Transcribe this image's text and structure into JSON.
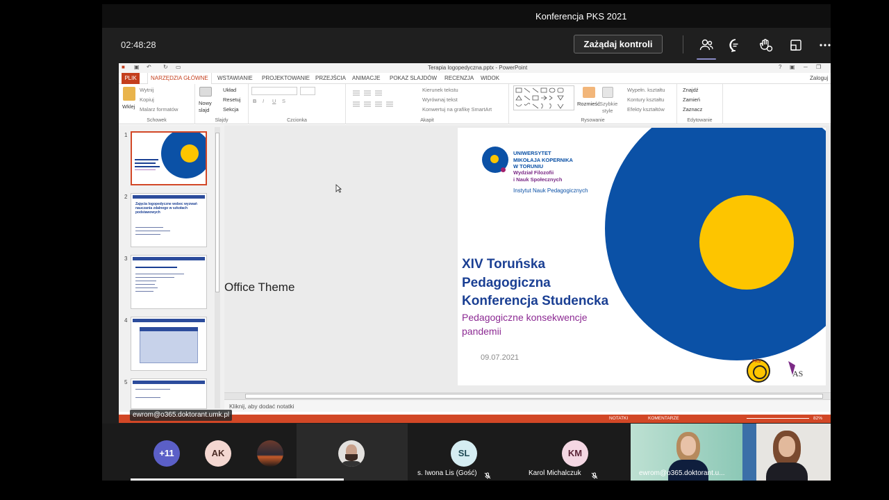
{
  "window": {
    "title": "Konferencja PKS 2021"
  },
  "controls": {
    "timer": "02:48:28",
    "request_control": "Zażądaj kontroli"
  },
  "ppt": {
    "title": "Terapia logopedyczna.pptx - PowerPoint",
    "signin": "Zaloguj",
    "tabs": [
      "PLIK",
      "NARZĘDZIA GŁÓWNE",
      "WSTAWIANIE",
      "PROJEKTOWANIE",
      "PRZEJŚCIA",
      "ANIMACJE",
      "POKAZ SLAJDÓW",
      "RECENZJA",
      "WIDOK"
    ],
    "ribbon": {
      "clipboard": {
        "paste": "Wklej",
        "cut": "Wytnij",
        "copy": "Kopiuj",
        "format_painter": "Malarz formatów",
        "group": "Schowek"
      },
      "slides": {
        "new_slide_1": "Nowy",
        "new_slide_2": "slajd",
        "layout": "Układ",
        "reset": "Resetuj",
        "section": "Sekcja",
        "group": "Slajdy"
      },
      "font": {
        "group": "Czcionka"
      },
      "paragraph": {
        "text_direction": "Kierunek tekstu",
        "align_text": "Wyrównaj tekst",
        "smartart": "Konwertuj na grafikę SmartArt",
        "group": "Akapit"
      },
      "drawing": {
        "arrange": "Rozmieść",
        "quick_styles_1": "Szybkie",
        "quick_styles_2": "style",
        "fill": "Wypełn. kształtu",
        "outline": "Kontury kształtu",
        "effects": "Efekty kształtów",
        "group": "Rysowanie"
      },
      "editing": {
        "find": "Znajdź",
        "replace": "Zamień",
        "select": "Zaznacz",
        "group": "Edytowanie"
      }
    },
    "slide_numbers": [
      "1",
      "2",
      "3",
      "4",
      "5"
    ],
    "thumb2_title": "Zajęcia logopedyczne wobec wyzwań nauczania zdalnego w szkołach podstawowych",
    "office_theme": "Office Theme",
    "notes_placeholder": "Kliknij, aby dodać notatki",
    "status": {
      "notes": "NOTATKI",
      "comments": "KOMENTARZE",
      "zoom": "82%"
    }
  },
  "slide": {
    "uni_lines": [
      "UNIWERSYTET",
      "MIKOŁAJA KOPERNIKA",
      "W TORUNIU"
    ],
    "faculty_lines": [
      "Wydział Filozofii",
      "i Nauk Społecznych"
    ],
    "institute": "Instytut Nauk Pedagogicznych",
    "title_lines": [
      "XIV Toruńska",
      "Pedagogiczna",
      "Konferencja Studencka"
    ],
    "subtitle_lines": [
      "Pedagogiczne konsekwencje",
      "pandemii"
    ],
    "date": "09.07.2021",
    "pks_logo_text": "PKS"
  },
  "presenter_tag": "ewrom@o365.doktorant.umk.pl",
  "participants": [
    {
      "label": "+11",
      "color": "#5b5fc7",
      "text_color": "#ffffff"
    },
    {
      "label": "AK",
      "color": "#f4d7d1",
      "text_color": "#4a2a24"
    },
    {
      "name": "s. Iwona Lis (Gość)",
      "initials": "SL",
      "color": "#d5edf2",
      "text_color": "#1e4a55"
    },
    {
      "name": "Karol Michalczuk",
      "initials": "KM",
      "color": "#f4d7e3",
      "text_color": "#5a2235"
    },
    {
      "name": "ewrom@o365.doktorant.u..."
    }
  ],
  "colors": {
    "teams_bg": "#1f1f1f",
    "ppt_accent": "#d24726",
    "umk_blue": "#0b51a6",
    "umk_yellow": "#fdc500",
    "umk_purple": "#8c2a93"
  }
}
